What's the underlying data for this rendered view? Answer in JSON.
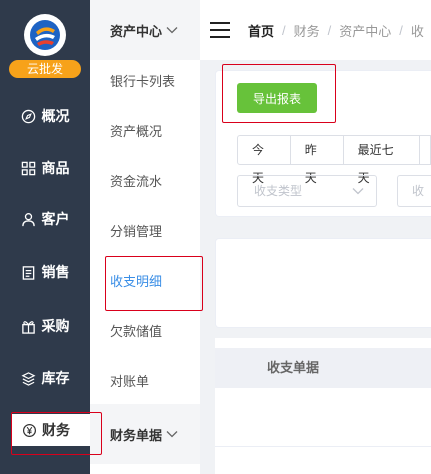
{
  "sidebar": {
    "brand": "云批发",
    "items": [
      {
        "label": "概况",
        "icon": "compass-icon"
      },
      {
        "label": "商品",
        "icon": "grid-icon"
      },
      {
        "label": "客户",
        "icon": "user-icon"
      },
      {
        "label": "销售",
        "icon": "clipboard-icon"
      },
      {
        "label": "采购",
        "icon": "gift-icon"
      },
      {
        "label": "库存",
        "icon": "layers-icon"
      },
      {
        "label": "财务",
        "icon": "yen-circle-icon"
      }
    ],
    "active": "财务"
  },
  "submenu": {
    "group1_title": "资产中心",
    "items": [
      "银行卡列表",
      "资产概况",
      "资金流水",
      "分销管理",
      "收支明细",
      "欠款储值",
      "对账单"
    ],
    "active": "收支明细",
    "group2_title": "财务单据"
  },
  "header": {
    "breadcrumb": [
      "首页",
      "财务",
      "资产中心",
      "收"
    ]
  },
  "toolbar": {
    "export_label": "导出报表"
  },
  "filters": {
    "date_tabs": [
      "今天",
      "昨天",
      "最近七天"
    ],
    "type_placeholder": "收支类型",
    "second_placeholder": "收"
  },
  "table": {
    "columns": [
      "收支单据"
    ]
  },
  "colors": {
    "sidebar_bg": "#2f3a4b",
    "brand_badge": "#f7a21a",
    "export_button": "#67c23a",
    "active_link": "#3a8ee6",
    "highlight_border": "#d9001b"
  }
}
